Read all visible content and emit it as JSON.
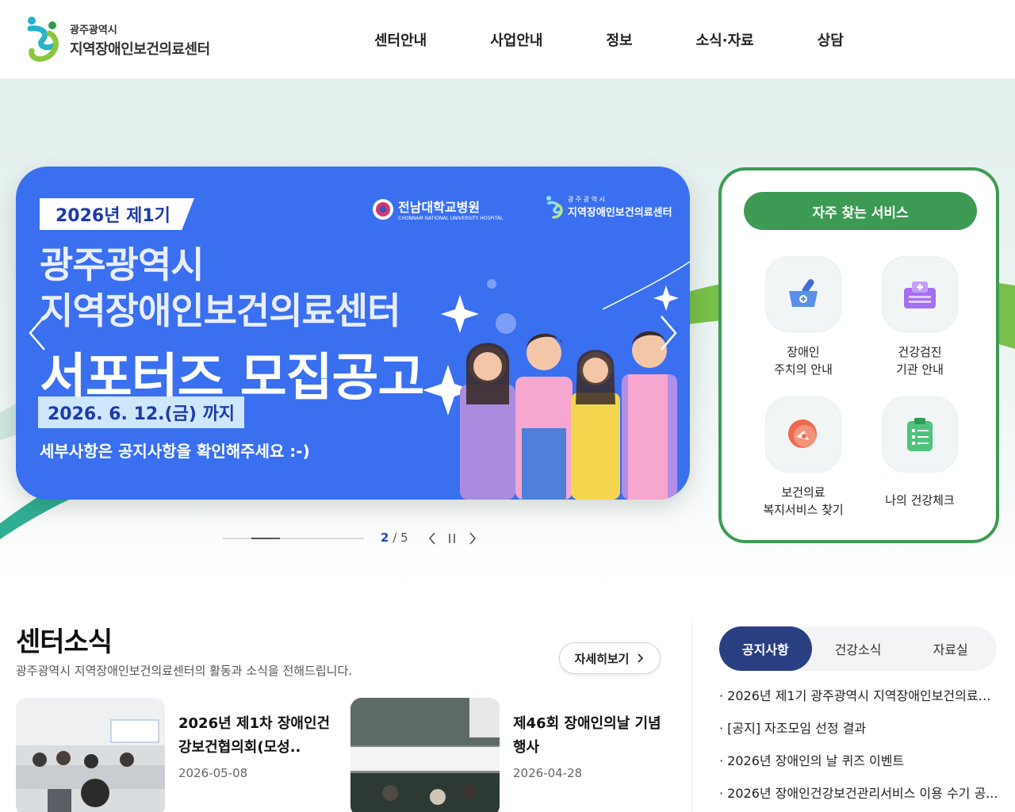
{
  "header": {
    "logo_small": "광주광역시",
    "logo_big": "지역장애인보건의료센터",
    "nav": [
      "센터안내",
      "사업안내",
      "정보",
      "소식·자료",
      "상담"
    ]
  },
  "banner": {
    "tag": "2026년 제1기",
    "title_line1": "광주광역시",
    "title_line2": "지역장애인보건의료센터",
    "title_line3": "서포터즈 모집공고",
    "date": "2026. 6. 12.(금) 까지",
    "note": "세부사항은 공지사항을 확인해주세요 :-)",
    "partner1": "전남대학교병원",
    "partner1_sub": "CHONNAM NATIONAL UNIVERSITY HOSPITAL",
    "partner2_small": "광 주 광 역 시",
    "partner2": "지역장애인보건의료센터"
  },
  "slider": {
    "current": "2",
    "separator": "/",
    "total": "5",
    "progress": 0.4
  },
  "quick": {
    "title": "자주 찾는 서비스",
    "items": [
      {
        "label": "장애인\n주치의 안내",
        "icon": "medicine-mortar-icon"
      },
      {
        "label": "건강검진\n기관 안내",
        "icon": "hospital-building-icon"
      },
      {
        "label": "보건의료\n복지서비스 찾기",
        "icon": "search-pin-icon"
      },
      {
        "label": "나의 건강체크",
        "icon": "clipboard-checklist-icon"
      }
    ]
  },
  "news": {
    "title": "센터소식",
    "subtitle": "광주광역시 지역장애인보건의료센터의 활동과 소식을 전해드립니다.",
    "more_label": "자세히보기",
    "cards": [
      {
        "title": "2026년 제1차 장애인건강보건협의회(모성..",
        "date": "2026-05-08"
      },
      {
        "title": "제46회 장애인의날 기념행사",
        "date": "2026-04-28"
      }
    ]
  },
  "notices": {
    "tabs": [
      "공지사항",
      "건강소식",
      "자료실"
    ],
    "active_tab": 0,
    "items": [
      "· 2026년 제1기 광주광역시 지역장애인보건의료센...",
      "· [공지] 자조모임 선정 결과",
      "· 2026년 장애인의 날 퀴즈 이벤트",
      "· 2026년 장애인건강보건관리서비스 이용 수기 공..."
    ]
  },
  "colors": {
    "brand_green": "#3d9a54",
    "banner_blue": "#3a6ff0",
    "tab_active": "#2a3f82",
    "page_current": "#2448b8"
  }
}
